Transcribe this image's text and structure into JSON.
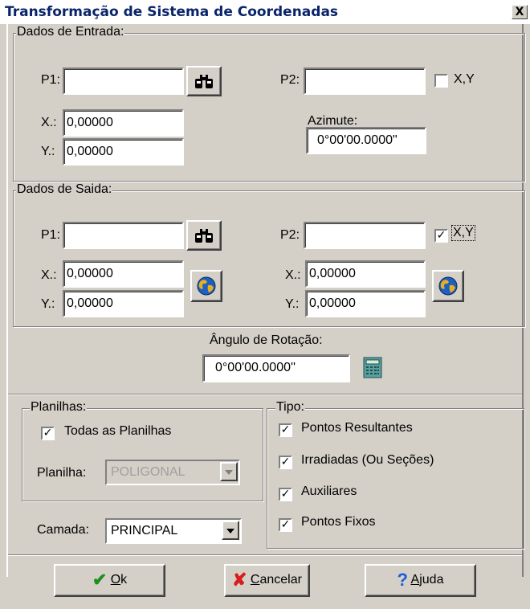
{
  "window": {
    "title": "Transformação de Sistema de Coordenadas",
    "close_glyph": "X"
  },
  "entrada": {
    "legend": "Dados de Entrada:",
    "p1_label": "P1:",
    "p1_value": "",
    "p2_label": "P2:",
    "p2_value": "",
    "xy_label": "X,Y",
    "xy_checked": false,
    "x_label": "X.:",
    "x_value": "0,00000",
    "y_label": "Y.:",
    "y_value": "0,00000",
    "azimute_label": "Azimute:",
    "azimute_value": "0°00'00.0000\""
  },
  "saida": {
    "legend": "Dados de Saida:",
    "p1_label": "P1:",
    "p1_value": "",
    "p2_label": "P2:",
    "p2_value": "",
    "xy_label": "X,Y",
    "xy_checked": true,
    "x1_label": "X.:",
    "x1_value": "0,00000",
    "y1_label": "Y.:",
    "y1_value": "0,00000",
    "x2_label": "X.:",
    "x2_value": "0,00000",
    "y2_label": "Y.:",
    "y2_value": "0,00000"
  },
  "rotacao": {
    "label": "Ângulo de Rotação:",
    "value": "0°00'00.0000''"
  },
  "planilhas": {
    "legend": "Planilhas:",
    "todas_label": "Todas as Planilhas",
    "todas_checked": true,
    "planilha_label": "Planilha:",
    "planilha_value": "POLIGONAL"
  },
  "camada": {
    "label": "Camada:",
    "value": "PRINCIPAL"
  },
  "tipo": {
    "legend": "Tipo:",
    "items": [
      {
        "label": "Pontos Resultantes",
        "checked": true
      },
      {
        "label": "Irradiadas (Ou Seções)",
        "checked": true
      },
      {
        "label": "Auxiliares",
        "checked": true
      },
      {
        "label": "Pontos Fixos",
        "checked": true
      }
    ]
  },
  "buttons": {
    "ok_mnemonic": "O",
    "ok_rest": "k",
    "cancel_mnemonic": "C",
    "cancel_rest": "ancelar",
    "help_mnemonic": "A",
    "help_rest": "juda"
  },
  "icons": {
    "binoculars": "binoculars-icon",
    "globe": "globe-icon",
    "calculator": "calculator-icon",
    "check": "check-icon",
    "x": "cross-icon",
    "help": "question-icon"
  },
  "colors": {
    "title_text": "#0a246a",
    "dialog_bg": "#d4d0c8",
    "ok_check": "#1f8f1f",
    "cancel_x": "#d81e1e",
    "help_q": "#1e5cd8"
  }
}
